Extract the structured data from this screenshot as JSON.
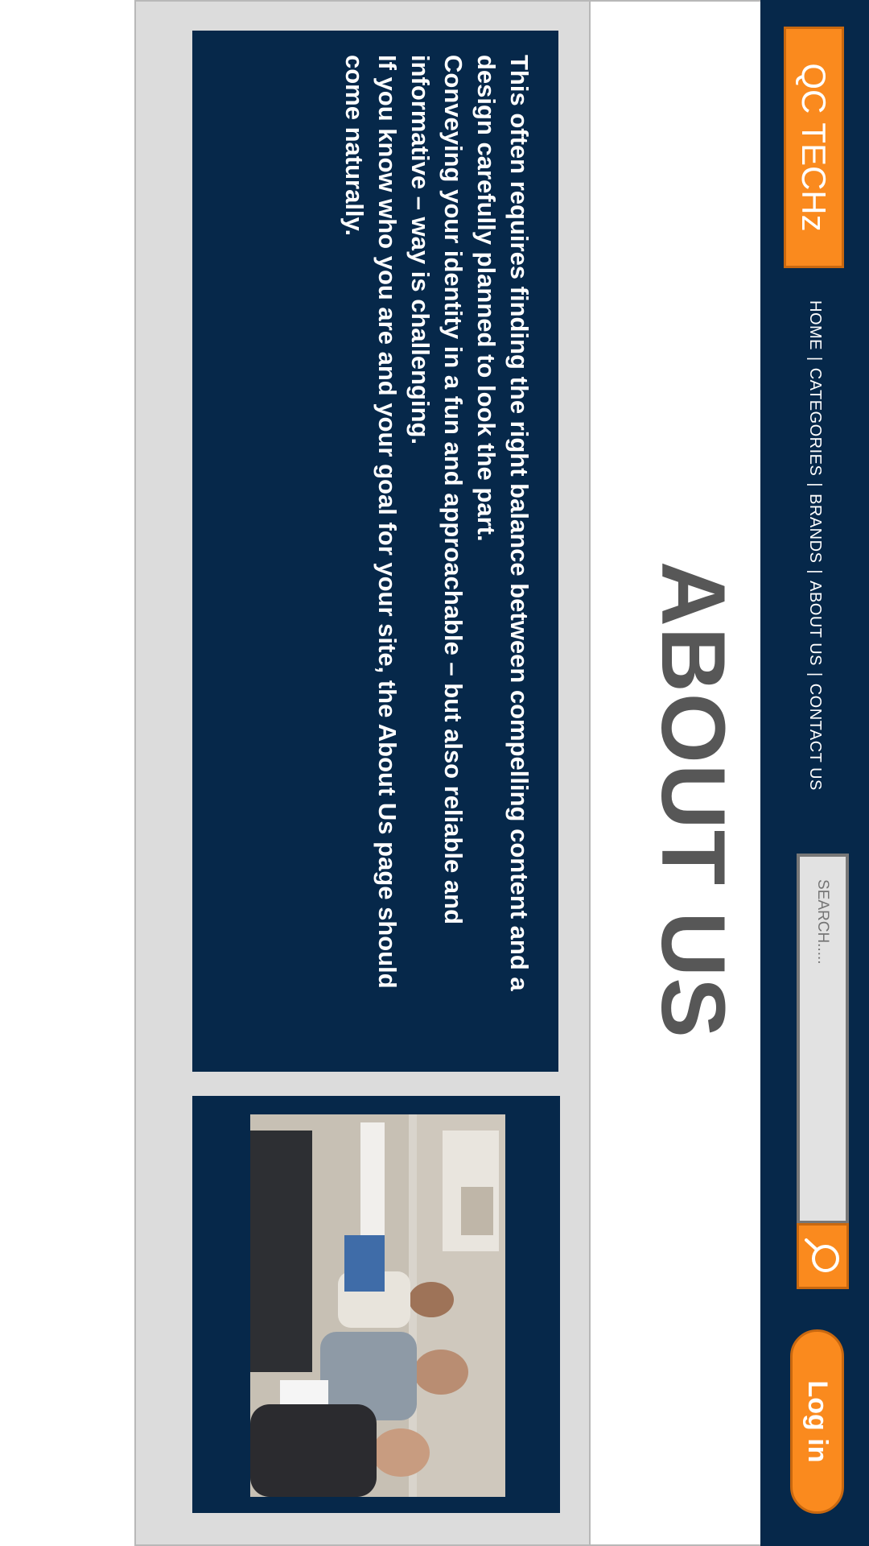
{
  "header": {
    "logo_text": "QC TECHz",
    "nav": [
      "HOME",
      "CATEGORIES",
      "BRANDS",
      "ABOUT US",
      "CONTACT US"
    ],
    "nav_separator": "|",
    "search_placeholder": "SEARCH.....",
    "search_icon": "search-icon",
    "login_label": "Log in"
  },
  "main": {
    "title": "ABOUT US",
    "paragraphs": [
      "This often requires finding the right balance between compelling content and a design carefully planned to look the part.",
      "Conveying your identity in a fun and approachable – but also reliable and informative – way is challenging.",
      "If you know who you are and your goal for your site, the About Us page should come naturally."
    ],
    "image_description": "team-photo"
  },
  "colors": {
    "navy": "#06284a",
    "orange": "#fa8a1e",
    "gray_band": "#dcdcdc",
    "title_gray": "#575757"
  }
}
